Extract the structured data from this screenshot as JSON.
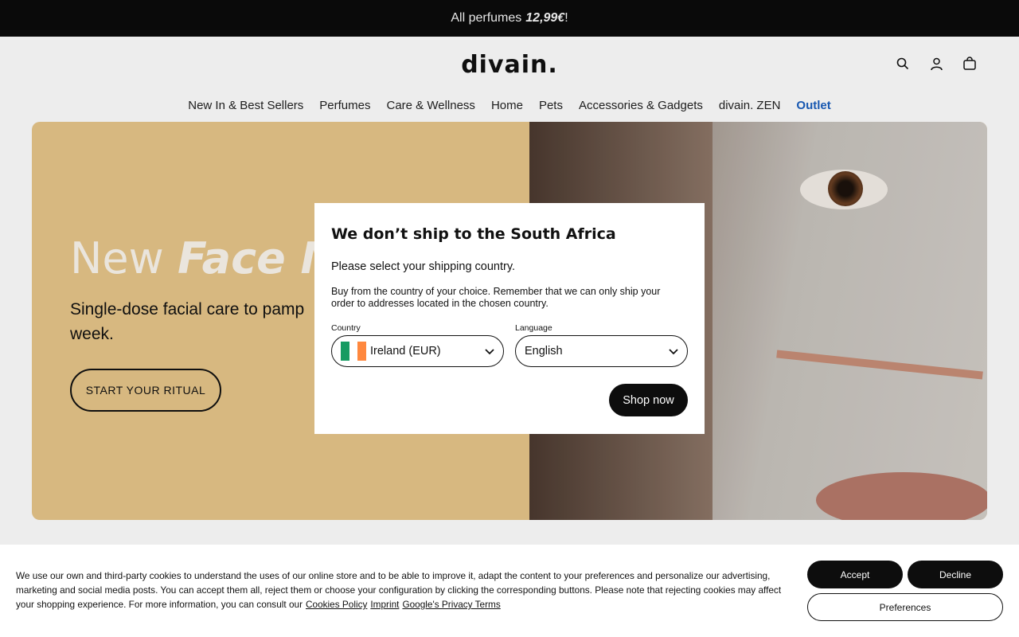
{
  "promo": {
    "text": "All perfumes",
    "price": "12,99€",
    "suffix": "!"
  },
  "header": {
    "logo": "divain.",
    "icons": [
      "search-icon",
      "account-icon",
      "cart-icon"
    ]
  },
  "nav": {
    "items": [
      "New In & Best Sellers",
      "Perfumes",
      "Care & Wellness",
      "Home",
      "Pets",
      "Accessories & Gadgets",
      "divain. ZEN"
    ],
    "highlight": "Outlet",
    "highlight_color": "#1a5fbf"
  },
  "hero": {
    "title_plain": "New",
    "title_emph": "Face M",
    "subtitle": "Single-dose facial care to pamp week.",
    "subtitle_line1": "Single-dose facial care to pamp",
    "subtitle_line2": "week.",
    "button": "START YOUR RITUAL",
    "bg_color": "#e8c68a"
  },
  "modal": {
    "title": "We don’t ship to the South Africa",
    "lead": "Please select your shipping country.",
    "body": "Buy from the country of your choice. Remember that we can only ship your order to addresses located in the chosen country.",
    "country_label": "Country",
    "country_value": "Ireland (EUR)",
    "language_label": "Language",
    "language_value": "English",
    "submit": "Shop now"
  },
  "cookies": {
    "text": "We use our own and third-party cookies to understand the uses of our online store and to be able to improve it, adapt the content to your preferences and personalize our advertising, marketing and social media posts. You can accept them all, reject them or choose your configuration by clicking the corresponding buttons. Please note that rejecting cookies may affect your shopping experience. For more information, you can consult our",
    "links": [
      "Cookies Policy",
      "Imprint",
      "Google's Privacy Terms"
    ],
    "accept": "Accept",
    "decline": "Decline",
    "preferences": "Preferences"
  }
}
